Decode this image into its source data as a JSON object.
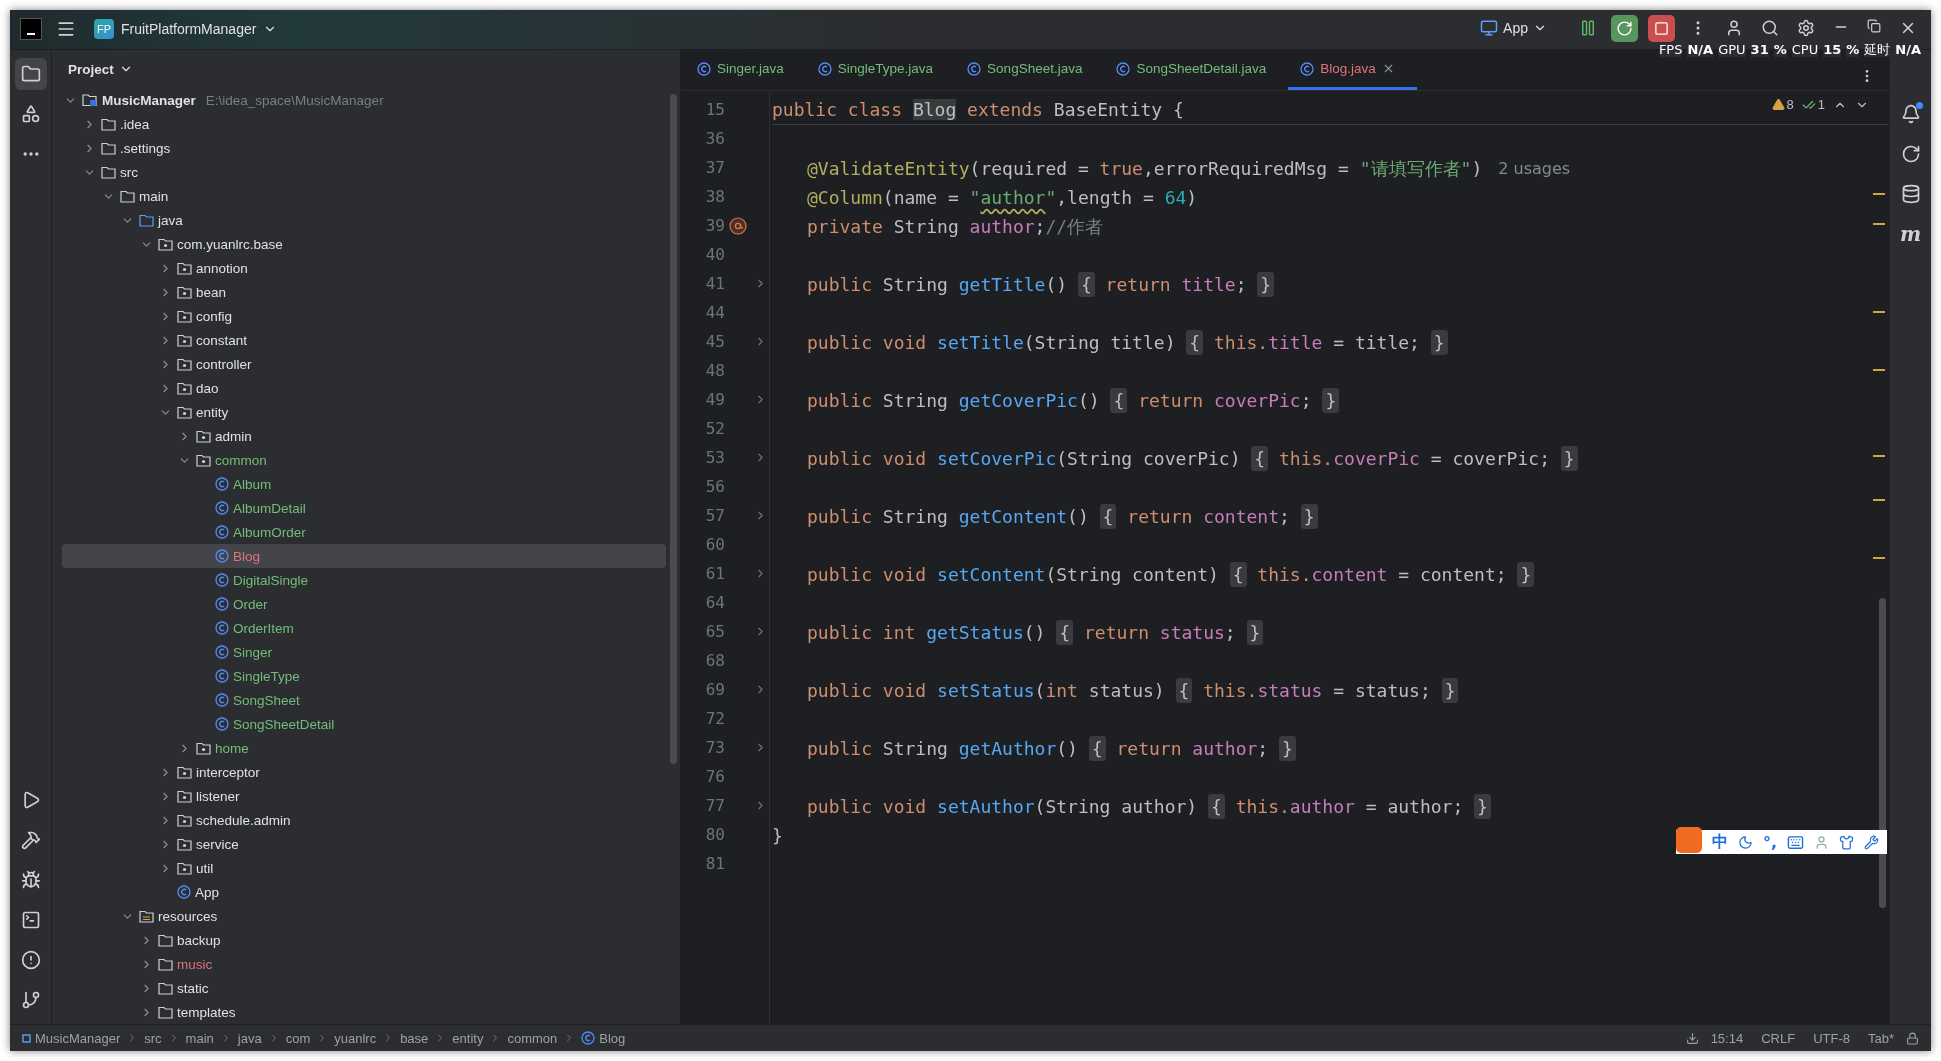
{
  "title_bar": {
    "project_badge": "FP",
    "project_name": "FruitPlatformManager",
    "run_config": "App"
  },
  "perf_overlay": [
    {
      "text": "FPS",
      "bold": false
    },
    {
      "text": "N/A",
      "bold": true
    },
    {
      "text": "GPU",
      "bold": false
    },
    {
      "text": "31",
      "bold": true
    },
    {
      "text": "%",
      "bold": true
    },
    {
      "text": "CPU",
      "bold": false
    },
    {
      "text": "15",
      "bold": true
    },
    {
      "text": "%",
      "bold": true
    },
    {
      "text": "延时",
      "bold": false
    },
    {
      "text": "N/A",
      "bold": true
    }
  ],
  "left_tools": {
    "top": [
      {
        "kind": "project",
        "selected": true
      },
      {
        "kind": "structure",
        "selected": false
      },
      {
        "kind": "more",
        "selected": false
      }
    ],
    "bottom": [
      {
        "kind": "run",
        "selected": false
      },
      {
        "kind": "build",
        "selected": false
      },
      {
        "kind": "debug",
        "selected": false
      },
      {
        "kind": "terminal",
        "selected": false
      },
      {
        "kind": "problems",
        "selected": false
      },
      {
        "kind": "git",
        "selected": false
      }
    ]
  },
  "project_panel": {
    "title": "Project",
    "tree": [
      {
        "label": "MusicManager",
        "path": "E:\\idea_space\\MusicManager",
        "kind": "module",
        "expanded": true,
        "selected": false,
        "children": [
          {
            "label": ".idea",
            "kind": "folder",
            "expanded": false,
            "selected": false
          },
          {
            "label": ".settings",
            "kind": "folder",
            "expanded": false,
            "selected": false
          },
          {
            "label": "src",
            "kind": "folder",
            "expanded": true,
            "selected": false,
            "children": [
              {
                "label": "main",
                "kind": "folder",
                "expanded": true,
                "selected": false,
                "children": [
                  {
                    "label": "java",
                    "kind": "source",
                    "expanded": true,
                    "selected": false,
                    "children": [
                      {
                        "label": "com.yuanlrc.base",
                        "kind": "package",
                        "expanded": true,
                        "selected": false,
                        "children": [
                          {
                            "label": "annotion",
                            "kind": "package",
                            "expanded": false,
                            "selected": false
                          },
                          {
                            "label": "bean",
                            "kind": "package",
                            "expanded": false,
                            "selected": false
                          },
                          {
                            "label": "config",
                            "kind": "package",
                            "expanded": false,
                            "selected": false
                          },
                          {
                            "label": "constant",
                            "kind": "package",
                            "expanded": false,
                            "selected": false
                          },
                          {
                            "label": "controller",
                            "kind": "package",
                            "expanded": false,
                            "selected": false
                          },
                          {
                            "label": "dao",
                            "kind": "package",
                            "expanded": false,
                            "selected": false
                          },
                          {
                            "label": "entity",
                            "kind": "package",
                            "expanded": true,
                            "selected": false,
                            "children": [
                              {
                                "label": "admin",
                                "kind": "package",
                                "expanded": false,
                                "selected": false
                              },
                              {
                                "label": "common",
                                "kind": "package",
                                "expanded": true,
                                "color": "#73bd79",
                                "selected": false,
                                "children": [
                                  {
                                    "label": "Album",
                                    "kind": "class",
                                    "color": "#73bd79",
                                    "selected": false
                                  },
                                  {
                                    "label": "AlbumDetail",
                                    "kind": "class",
                                    "color": "#73bd79",
                                    "selected": false
                                  },
                                  {
                                    "label": "AlbumOrder",
                                    "kind": "class",
                                    "color": "#73bd79",
                                    "selected": false
                                  },
                                  {
                                    "label": "Blog",
                                    "kind": "class",
                                    "color": "#e0727a",
                                    "selected": true
                                  },
                                  {
                                    "label": "DigitalSingle",
                                    "kind": "class",
                                    "color": "#73bd79",
                                    "selected": false
                                  },
                                  {
                                    "label": "Order",
                                    "kind": "class",
                                    "color": "#73bd79",
                                    "selected": false
                                  },
                                  {
                                    "label": "OrderItem",
                                    "kind": "class",
                                    "color": "#73bd79",
                                    "selected": false
                                  },
                                  {
                                    "label": "Singer",
                                    "kind": "class",
                                    "color": "#73bd79",
                                    "selected": false
                                  },
                                  {
                                    "label": "SingleType",
                                    "kind": "class",
                                    "color": "#73bd79",
                                    "selected": false
                                  },
                                  {
                                    "label": "SongSheet",
                                    "kind": "class",
                                    "color": "#73bd79",
                                    "selected": false
                                  },
                                  {
                                    "label": "SongSheetDetail",
                                    "kind": "class",
                                    "color": "#73bd79",
                                    "selected": false
                                  }
                                ]
                              },
                              {
                                "label": "home",
                                "kind": "package",
                                "expanded": false,
                                "color": "#73bd79",
                                "selected": false
                              }
                            ]
                          },
                          {
                            "label": "interceptor",
                            "kind": "package",
                            "expanded": false,
                            "selected": false
                          },
                          {
                            "label": "listener",
                            "kind": "package",
                            "expanded": false,
                            "selected": false
                          },
                          {
                            "label": "schedule.admin",
                            "kind": "package",
                            "expanded": false,
                            "selected": false
                          },
                          {
                            "label": "service",
                            "kind": "package",
                            "expanded": false,
                            "selected": false
                          },
                          {
                            "label": "util",
                            "kind": "package",
                            "expanded": false,
                            "selected": false
                          },
                          {
                            "label": "App",
                            "kind": "app",
                            "selected": false
                          }
                        ]
                      }
                    ]
                  },
                  {
                    "label": "resources",
                    "kind": "resources",
                    "expanded": true,
                    "selected": false,
                    "children": [
                      {
                        "label": "backup",
                        "kind": "folder",
                        "expanded": false,
                        "selected": false
                      },
                      {
                        "label": "music",
                        "kind": "folder",
                        "expanded": false,
                        "color": "#e0727a",
                        "selected": false
                      },
                      {
                        "label": "static",
                        "kind": "folder",
                        "expanded": false,
                        "selected": false
                      },
                      {
                        "label": "templates",
                        "kind": "folder",
                        "expanded": false,
                        "selected": false
                      }
                    ]
                  }
                ]
              }
            ]
          }
        ]
      }
    ]
  },
  "editor": {
    "tabs": [
      {
        "label": "Singer.java",
        "color": "#73bd79",
        "selected": false,
        "closable": false
      },
      {
        "label": "SingleType.java",
        "color": "#73bd79",
        "selected": false,
        "closable": false
      },
      {
        "label": "SongSheet.java",
        "color": "#73bd79",
        "selected": false,
        "closable": false
      },
      {
        "label": "SongSheetDetail.java",
        "color": "#73bd79",
        "selected": false,
        "closable": false
      },
      {
        "label": "Blog.java",
        "color": "#e0727a",
        "selected": true,
        "closable": true
      }
    ],
    "inspections": {
      "warnings": "8",
      "weak_warnings": "1"
    },
    "lines": [
      {
        "number": "15",
        "indented": false,
        "foldable": false,
        "tokens": [
          {
            "text": "public ",
            "kind": "keyword"
          },
          {
            "text": "class ",
            "kind": "keyword"
          },
          {
            "text": "Blog",
            "kind": "plain",
            "highlight": true
          },
          {
            "text": " extends ",
            "kind": "keyword"
          },
          {
            "text": "BaseEntity {",
            "kind": "plain"
          }
        ]
      },
      {
        "number": "36",
        "foldable": false
      },
      {
        "number": "37",
        "indented": true,
        "foldable": false,
        "tokens": [
          {
            "text": "@ValidateEntity",
            "kind": "annotation"
          },
          {
            "text": "(required = ",
            "kind": "plain"
          },
          {
            "text": "true",
            "kind": "keyword"
          },
          {
            "text": ",errorRequiredMsg = ",
            "kind": "plain"
          },
          {
            "text": "\"请填写作者\"",
            "kind": "string"
          },
          {
            "text": ")",
            "kind": "plain"
          }
        ],
        "hint": "2 usages"
      },
      {
        "number": "38",
        "indented": true,
        "foldable": false,
        "tokens": [
          {
            "text": "@Column",
            "kind": "annotation"
          },
          {
            "text": "(name = ",
            "kind": "plain"
          },
          {
            "text": "\"",
            "kind": "string"
          },
          {
            "text": "author",
            "kind": "string",
            "typo": true
          },
          {
            "text": "\"",
            "kind": "string"
          },
          {
            "text": ",length = ",
            "kind": "plain"
          },
          {
            "text": "64",
            "kind": "number"
          },
          {
            "text": ")",
            "kind": "plain"
          }
        ]
      },
      {
        "number": "39",
        "indented": true,
        "foldable": false,
        "override_marker": true,
        "tokens": [
          {
            "text": "private ",
            "kind": "keyword"
          },
          {
            "text": "String ",
            "kind": "plain"
          },
          {
            "text": "author",
            "kind": "field"
          },
          {
            "text": ";",
            "kind": "plain"
          },
          {
            "text": "//作者",
            "kind": "comment"
          }
        ]
      },
      {
        "number": "40",
        "foldable": false
      },
      {
        "number": "41",
        "indented": true,
        "foldable": true,
        "tokens": [
          {
            "text": "public ",
            "kind": "keyword"
          },
          {
            "text": "String ",
            "kind": "plain"
          },
          {
            "text": "getTitle",
            "kind": "method"
          },
          {
            "text": "() ",
            "kind": "plain"
          },
          {
            "text": "{",
            "kind": "fold"
          },
          {
            "text": " return ",
            "kind": "keyword"
          },
          {
            "text": "title",
            "kind": "field"
          },
          {
            "text": "; ",
            "kind": "plain"
          },
          {
            "text": "}",
            "kind": "fold"
          }
        ]
      },
      {
        "number": "44",
        "foldable": false
      },
      {
        "number": "45",
        "indented": true,
        "foldable": true,
        "tokens": [
          {
            "text": "public ",
            "kind": "keyword"
          },
          {
            "text": "void ",
            "kind": "keyword"
          },
          {
            "text": "setTitle",
            "kind": "method"
          },
          {
            "text": "(String title) ",
            "kind": "plain"
          },
          {
            "text": "{",
            "kind": "fold"
          },
          {
            "text": " this.",
            "kind": "keyword"
          },
          {
            "text": "title",
            "kind": "field"
          },
          {
            "text": " = title; ",
            "kind": "plain"
          },
          {
            "text": "}",
            "kind": "fold"
          }
        ]
      },
      {
        "number": "48",
        "foldable": false
      },
      {
        "number": "49",
        "indented": true,
        "foldable": true,
        "tokens": [
          {
            "text": "public ",
            "kind": "keyword"
          },
          {
            "text": "String ",
            "kind": "plain"
          },
          {
            "text": "getCoverPic",
            "kind": "method"
          },
          {
            "text": "() ",
            "kind": "plain"
          },
          {
            "text": "{",
            "kind": "fold"
          },
          {
            "text": " return ",
            "kind": "keyword"
          },
          {
            "text": "coverPic",
            "kind": "field"
          },
          {
            "text": "; ",
            "kind": "plain"
          },
          {
            "text": "}",
            "kind": "fold"
          }
        ]
      },
      {
        "number": "52",
        "foldable": false
      },
      {
        "number": "53",
        "indented": true,
        "foldable": true,
        "tokens": [
          {
            "text": "public ",
            "kind": "keyword"
          },
          {
            "text": "void ",
            "kind": "keyword"
          },
          {
            "text": "setCoverPic",
            "kind": "method"
          },
          {
            "text": "(String coverPic) ",
            "kind": "plain"
          },
          {
            "text": "{",
            "kind": "fold"
          },
          {
            "text": " this.",
            "kind": "keyword"
          },
          {
            "text": "coverPic",
            "kind": "field"
          },
          {
            "text": " = coverPic; ",
            "kind": "plain"
          },
          {
            "text": "}",
            "kind": "fold"
          }
        ]
      },
      {
        "number": "56",
        "foldable": false
      },
      {
        "number": "57",
        "indented": true,
        "foldable": true,
        "tokens": [
          {
            "text": "public ",
            "kind": "keyword"
          },
          {
            "text": "String ",
            "kind": "plain"
          },
          {
            "text": "getContent",
            "kind": "method"
          },
          {
            "text": "() ",
            "kind": "plain"
          },
          {
            "text": "{",
            "kind": "fold"
          },
          {
            "text": " return ",
            "kind": "keyword"
          },
          {
            "text": "content",
            "kind": "field"
          },
          {
            "text": "; ",
            "kind": "plain"
          },
          {
            "text": "}",
            "kind": "fold"
          }
        ]
      },
      {
        "number": "60",
        "foldable": false
      },
      {
        "number": "61",
        "indented": true,
        "foldable": true,
        "tokens": [
          {
            "text": "public ",
            "kind": "keyword"
          },
          {
            "text": "void ",
            "kind": "keyword"
          },
          {
            "text": "setContent",
            "kind": "method"
          },
          {
            "text": "(String content) ",
            "kind": "plain"
          },
          {
            "text": "{",
            "kind": "fold"
          },
          {
            "text": " this.",
            "kind": "keyword"
          },
          {
            "text": "content",
            "kind": "field"
          },
          {
            "text": " = content; ",
            "kind": "plain"
          },
          {
            "text": "}",
            "kind": "fold"
          }
        ]
      },
      {
        "number": "64",
        "foldable": false
      },
      {
        "number": "65",
        "indented": true,
        "foldable": true,
        "tokens": [
          {
            "text": "public ",
            "kind": "keyword"
          },
          {
            "text": "int ",
            "kind": "keyword"
          },
          {
            "text": "getStatus",
            "kind": "method"
          },
          {
            "text": "() ",
            "kind": "plain"
          },
          {
            "text": "{",
            "kind": "fold"
          },
          {
            "text": " return ",
            "kind": "keyword"
          },
          {
            "text": "status",
            "kind": "field"
          },
          {
            "text": "; ",
            "kind": "plain"
          },
          {
            "text": "}",
            "kind": "fold"
          }
        ]
      },
      {
        "number": "68",
        "foldable": false
      },
      {
        "number": "69",
        "indented": true,
        "foldable": true,
        "tokens": [
          {
            "text": "public ",
            "kind": "keyword"
          },
          {
            "text": "void ",
            "kind": "keyword"
          },
          {
            "text": "setStatus",
            "kind": "method"
          },
          {
            "text": "(",
            "kind": "plain"
          },
          {
            "text": "int",
            "kind": "keyword"
          },
          {
            "text": " status) ",
            "kind": "plain"
          },
          {
            "text": "{",
            "kind": "fold"
          },
          {
            "text": " this.",
            "kind": "keyword"
          },
          {
            "text": "status",
            "kind": "field"
          },
          {
            "text": " = status; ",
            "kind": "plain"
          },
          {
            "text": "}",
            "kind": "fold"
          }
        ]
      },
      {
        "number": "72",
        "foldable": false
      },
      {
        "number": "73",
        "indented": true,
        "foldable": true,
        "tokens": [
          {
            "text": "public ",
            "kind": "keyword"
          },
          {
            "text": "String ",
            "kind": "plain"
          },
          {
            "text": "getAuthor",
            "kind": "method"
          },
          {
            "text": "() ",
            "kind": "plain"
          },
          {
            "text": "{",
            "kind": "fold"
          },
          {
            "text": " return ",
            "kind": "keyword"
          },
          {
            "text": "author",
            "kind": "field"
          },
          {
            "text": "; ",
            "kind": "plain"
          },
          {
            "text": "}",
            "kind": "fold"
          }
        ]
      },
      {
        "number": "76",
        "foldable": false
      },
      {
        "number": "77",
        "indented": true,
        "foldable": true,
        "tokens": [
          {
            "text": "public ",
            "kind": "keyword"
          },
          {
            "text": "void ",
            "kind": "keyword"
          },
          {
            "text": "setAuthor",
            "kind": "method"
          },
          {
            "text": "(String author) ",
            "kind": "plain"
          },
          {
            "text": "{",
            "kind": "fold"
          },
          {
            "text": " this.",
            "kind": "keyword"
          },
          {
            "text": "author",
            "kind": "field"
          },
          {
            "text": " = author; ",
            "kind": "plain"
          },
          {
            "text": "}",
            "kind": "fold"
          }
        ]
      },
      {
        "number": "80",
        "indented": false,
        "foldable": false,
        "tokens": [
          {
            "text": "}",
            "kind": "plain"
          }
        ]
      },
      {
        "number": "81",
        "foldable": false
      }
    ]
  },
  "right_tools": [
    {
      "kind": "notifications",
      "badge": true
    },
    {
      "kind": "ai",
      "badge": false
    },
    {
      "kind": "database",
      "badge": false
    },
    {
      "kind": "maven",
      "glyph": "m",
      "badge": false
    }
  ],
  "ime_bar": {
    "mode": "中",
    "punctuation": "°,"
  },
  "status_bar": {
    "breadcrumbs": [
      {
        "label": "MusicManager",
        "kind": "module"
      },
      {
        "label": "src",
        "kind": "folder"
      },
      {
        "label": "main",
        "kind": "folder"
      },
      {
        "label": "java",
        "kind": "folder"
      },
      {
        "label": "com",
        "kind": "folder"
      },
      {
        "label": "yuanlrc",
        "kind": "folder"
      },
      {
        "label": "base",
        "kind": "folder"
      },
      {
        "label": "entity",
        "kind": "folder"
      },
      {
        "label": "common",
        "kind": "folder"
      },
      {
        "label": "Blog",
        "kind": "class"
      }
    ],
    "items": [
      "15:14",
      "CRLF",
      "UTF-8",
      "Tab*"
    ]
  }
}
